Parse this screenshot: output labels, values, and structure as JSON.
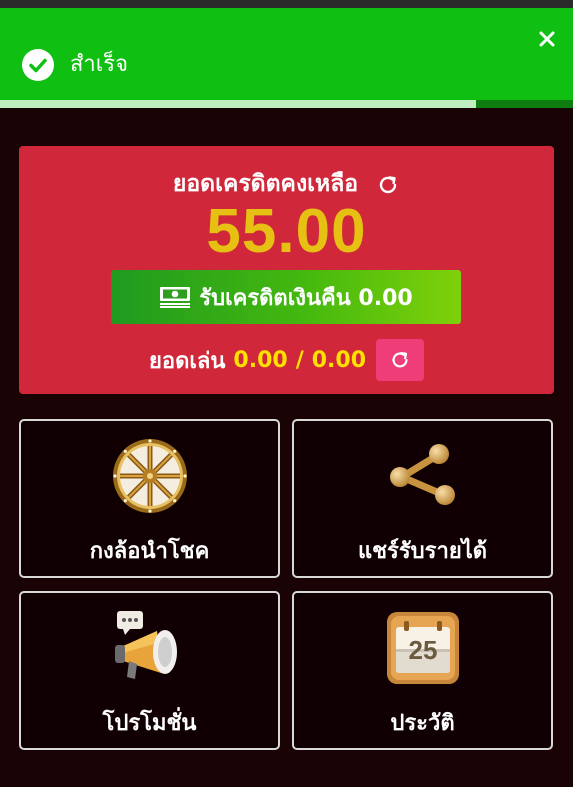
{
  "toast": {
    "message": "สำเร็จ",
    "progress": 0.83,
    "icon": "check-circle-icon",
    "close_icon": "close-icon",
    "color": "#0fbf12"
  },
  "credit": {
    "balance_label": "ยอดเครดิตคงเหลือ",
    "balance_value": "55.00",
    "cashback_label": "รับเครดิตเงินคืน 0.00",
    "turnover_label": "ยอดเล่น",
    "turnover_current": "0.00",
    "turnover_separator": "/",
    "turnover_target": "0.00",
    "card_color": "#d0283a",
    "amount_color": "#e6c012"
  },
  "menu": [
    {
      "label": "กงล้อนำโชค",
      "icon": "fortune-wheel-icon"
    },
    {
      "label": "แชร์รับรายได้",
      "icon": "share-icon"
    },
    {
      "label": "โปรโมชั่น",
      "icon": "megaphone-icon"
    },
    {
      "label": "ประวัติ",
      "icon": "calendar-icon"
    }
  ],
  "calendar_day": "25"
}
